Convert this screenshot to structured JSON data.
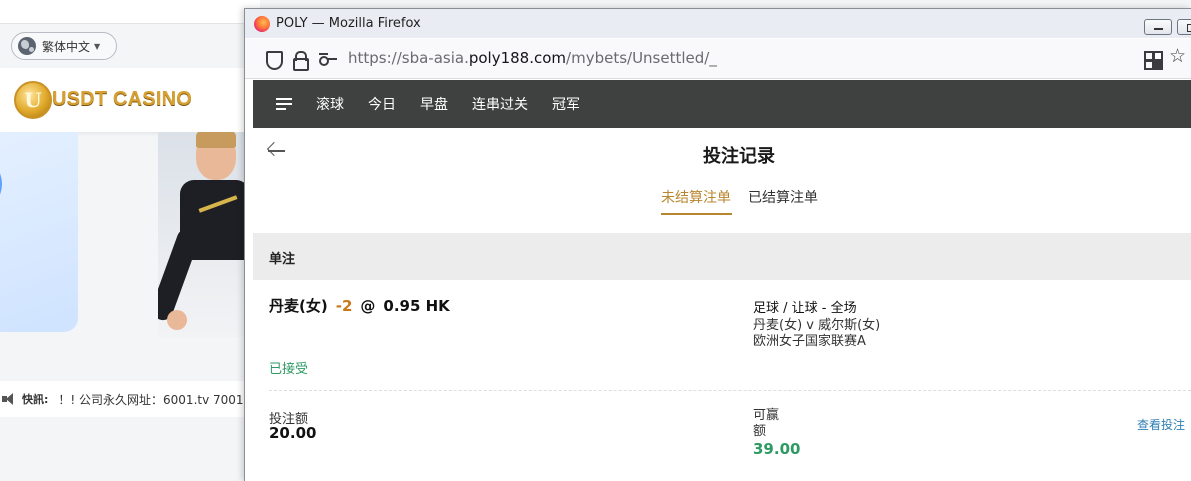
{
  "background_page": {
    "language_selector": "繁体中文",
    "logo_text": "USDT CASINO",
    "logo_coin_letter": "U",
    "ticker_label": "快訊:",
    "ticker_text": "！! 公司永久网址：6001.tv 7001."
  },
  "browser": {
    "window_title": "POLY — Mozilla Firefox",
    "url_prefix": "https://sba-asia.",
    "url_host": "poly188.com",
    "url_path": "/mybets/Unsettled/_",
    "star_glyph": "☆"
  },
  "sportsbook": {
    "nav_items": [
      "滚球",
      "今日",
      "早盘",
      "连串过关",
      "冠军"
    ],
    "page_title": "投注记录",
    "tabs": {
      "unsettled": "未结算注单",
      "settled": "已结算注单"
    },
    "section_title": "单注",
    "bet": {
      "selection": "丹麦(女)",
      "handicap": "-2",
      "at_symbol": "@",
      "odds": "0.95 HK",
      "market": "足球 / 让球 - 全场",
      "match": "丹麦(女) v 威尔斯(女)",
      "league": "欧洲女子国家联赛A",
      "status": "已接受",
      "stake_label": "投注额",
      "stake_value": "20.00",
      "win_label": "可赢额",
      "win_value": "39.00",
      "detail_link": "查看投注"
    }
  },
  "colors": {
    "accent_gold": "#b8862e",
    "handicap_orange": "#c7791a",
    "status_green": "#2e9a63",
    "nav_dark": "#3f4140",
    "link_blue": "#2d7fb5"
  }
}
